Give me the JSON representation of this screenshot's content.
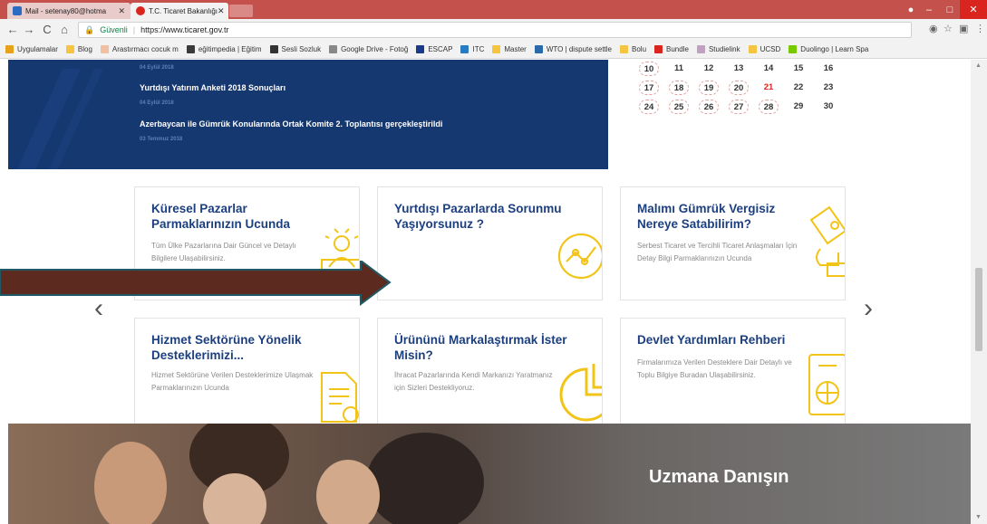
{
  "browser": {
    "tabs": [
      {
        "title": "Mail - setenay80@hotma",
        "active": false
      },
      {
        "title": "T.C. Ticaret Bakanlığı",
        "active": true
      }
    ],
    "secure_label": "Güvenli",
    "url": "https://www.ticaret.gov.tr",
    "bookmarks": [
      {
        "label": "Uygulamalar",
        "icon": "apps-grid-icon",
        "color": "#e8a21a"
      },
      {
        "label": "Blog",
        "icon": "folder-icon",
        "color": "#f5c542"
      },
      {
        "label": "Arastırmacı cocuk m",
        "icon": "page-icon",
        "color": "#f0c0a0"
      },
      {
        "label": "eğitimpedia | Eğitim",
        "icon": "site-icon",
        "color": "#3a3a3a"
      },
      {
        "label": "Sesli Sozluk",
        "icon": "site-icon",
        "color": "#333333"
      },
      {
        "label": "Google Drive - Fotoğ",
        "icon": "page-icon",
        "color": "#888888"
      },
      {
        "label": "ESCAP",
        "icon": "escap-icon",
        "color": "#1a3b8a"
      },
      {
        "label": "ITC",
        "icon": "itc-icon",
        "color": "#2a7cc2"
      },
      {
        "label": "Master",
        "icon": "folder-icon",
        "color": "#f5c542"
      },
      {
        "label": "WTO | dispute settle",
        "icon": "wto-icon",
        "color": "#2a6aaa"
      },
      {
        "label": "Bolu",
        "icon": "folder-icon",
        "color": "#f5c542"
      },
      {
        "label": "Bundle",
        "icon": "bundle-icon",
        "color": "#d9251d"
      },
      {
        "label": "Studielink",
        "icon": "studielink-icon",
        "color": "#c2a0c2"
      },
      {
        "label": "UCSD",
        "icon": "folder-icon",
        "color": "#f5c542"
      },
      {
        "label": "Duolingo | Learn Spa",
        "icon": "duolingo-icon",
        "color": "#78c800"
      }
    ]
  },
  "news": {
    "items": [
      {
        "date": "04 Eylül 2018",
        "title": ""
      },
      {
        "date": "04 Eylül 2018",
        "title": "Yurtdışı Yatırım Anketi 2018 Sonuçları"
      },
      {
        "date": "03 Temmuz 2018",
        "title": "Azerbaycan ile Gümrük Konularında Ortak Komite 2. Toplantısı gerçekleştirildi"
      }
    ]
  },
  "calendar": {
    "rows": [
      [
        {
          "n": "10",
          "c": true
        },
        {
          "n": "11"
        },
        {
          "n": "12"
        },
        {
          "n": "13"
        },
        {
          "n": "14"
        },
        {
          "n": "15"
        },
        {
          "n": "16"
        }
      ],
      [
        {
          "n": "17",
          "c": true
        },
        {
          "n": "18",
          "c": true
        },
        {
          "n": "19",
          "c": true
        },
        {
          "n": "20",
          "c": true
        },
        {
          "n": "21",
          "red": true
        },
        {
          "n": "22"
        },
        {
          "n": "23"
        }
      ],
      [
        {
          "n": "24",
          "c": true
        },
        {
          "n": "25",
          "c": true
        },
        {
          "n": "26",
          "c": true
        },
        {
          "n": "27",
          "c": true
        },
        {
          "n": "28",
          "c": true
        },
        {
          "n": "29"
        },
        {
          "n": "30"
        }
      ]
    ]
  },
  "cards": [
    {
      "title": "Küresel Pazarlar Parmaklarınızın Ucunda",
      "text": "Tüm Ülke Pazarlarına Dair Güncel ve Detaylı Bilgilere Ulaşabilirsiniz.",
      "icon": "globe-people-icon"
    },
    {
      "title": "Yurtdışı Pazarlarda Sorunmu Yaşıyorsunuz ?",
      "text": "",
      "icon": "chart-circle-icon"
    },
    {
      "title": "Malımı Gümrük Vergisiz Nereye Satabilirim?",
      "text": "Serbest Ticaret ve Tercihli Ticaret Anlaşmaları İçin Detay Bilgi Parmaklarınızın Ucunda",
      "icon": "hand-money-icon"
    },
    {
      "title": "Hizmet Sektörüne Yönelik Desteklerimizi...",
      "text": "Hizmet Sektörüne Verilen Desteklerimize Ulaşmak Parmaklarınızın Ucunda",
      "icon": "document-icon"
    },
    {
      "title": "Ürününü Markalaştırmak İster Misin?",
      "text": "İhracat Pazarlarında Kendi Markanızı Yaratmanız için Sizleri Destekliyoruz.",
      "icon": "pie-chart-icon"
    },
    {
      "title": "Devlet Yardımları Rehberi",
      "text": "Firmalarımıza Verilen Desteklere Dair Detaylı ve Toplu Bilgiye Buradan Ulaşabilirsiniz.",
      "icon": "passport-globe-icon"
    }
  ],
  "carousel": {
    "prev": "‹",
    "next": "›"
  },
  "expert_banner": {
    "title": "Uzmana Danışın"
  },
  "colors": {
    "brand_blue": "#1c3f80",
    "news_bg": "#163870",
    "icon_yellow": "#f2c417",
    "tabstrip": "#c4514c",
    "annotation_arrow": "#5c2a1e"
  }
}
